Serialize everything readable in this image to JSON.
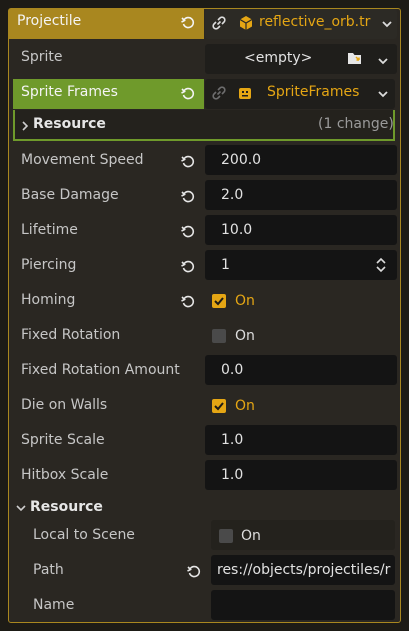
{
  "header": {
    "title": "Projectile",
    "resource_name": "reflective_orb.tr"
  },
  "sprite": {
    "label": "Sprite",
    "value": "<empty>"
  },
  "sprite_frames": {
    "label": "Sprite Frames",
    "value": "SpriteFrames"
  },
  "resource_sub": {
    "title": "Resource",
    "changes": "(1 change)"
  },
  "properties": [
    {
      "label": "Movement Speed",
      "value": "200.0"
    },
    {
      "label": "Base Damage",
      "value": "2.0"
    },
    {
      "label": "Lifetime",
      "value": "10.0"
    },
    {
      "label": "Piercing",
      "value": "1"
    },
    {
      "label": "Homing",
      "value": "On",
      "checked": true
    },
    {
      "label": "Fixed Rotation",
      "value": "On",
      "checked": false
    },
    {
      "label": "Fixed Rotation Amount",
      "value": "0.0"
    },
    {
      "label": "Die on Walls",
      "value": "On",
      "checked": true
    },
    {
      "label": "Sprite Scale",
      "value": "1.0"
    },
    {
      "label": "Hitbox Scale",
      "value": "1.0"
    }
  ],
  "resource_section": {
    "title": "Resource",
    "local_to_scene": {
      "label": "Local to Scene",
      "value": "On",
      "checked": false
    },
    "path": {
      "label": "Path",
      "value": "res://objects/projectiles/r"
    },
    "name": {
      "label": "Name",
      "value": ""
    }
  },
  "colors": {
    "accent": "#a9871f",
    "highlight": "#e5a614",
    "green": "#6f9a2b",
    "field": "#141414",
    "panel": "#2a2722"
  },
  "icons": [
    "revert-icon",
    "link-icon",
    "cube-icon",
    "chevron-down-icon",
    "folder-load-icon",
    "sprite-frames-icon",
    "chevron-right-icon",
    "spin-arrows-icon",
    "checkbox-icon"
  ]
}
